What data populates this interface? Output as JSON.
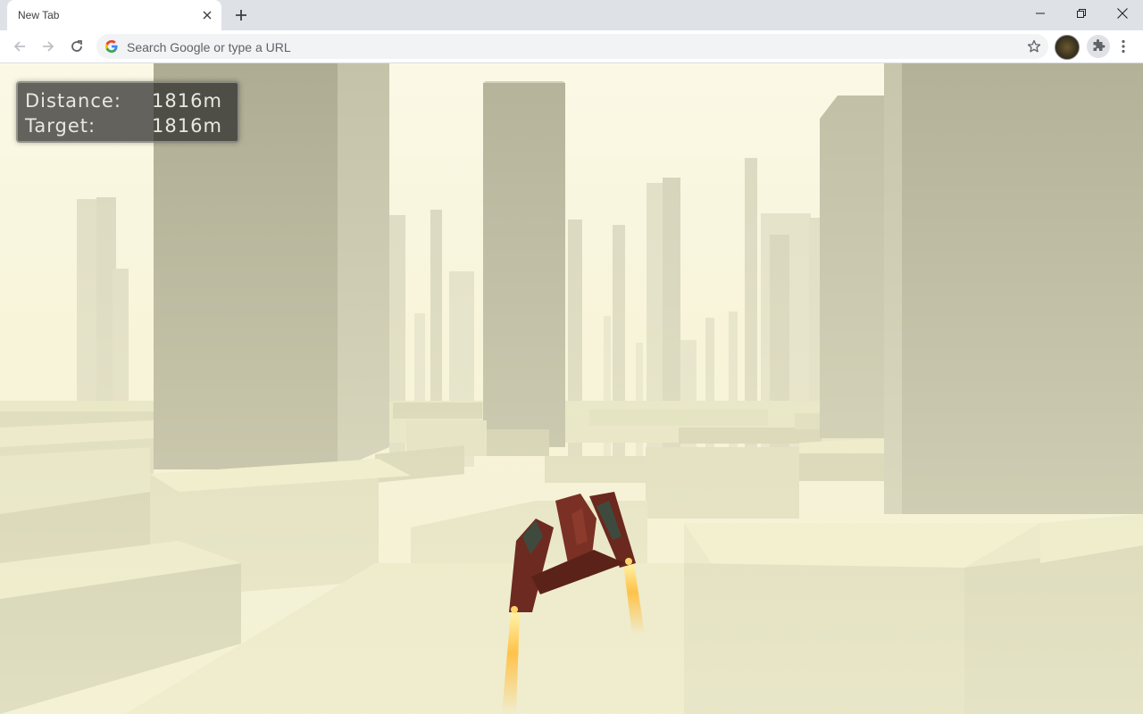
{
  "browser": {
    "tab_title": "New Tab",
    "omnibox_placeholder": "Search Google or type a URL",
    "icons": {
      "back": "arrow-left-icon",
      "forward": "arrow-right-icon",
      "reload": "reload-icon",
      "new_tab": "plus-icon",
      "close_tab": "close-icon",
      "bookmark": "star-icon",
      "extensions": "puzzle-icon",
      "menu": "kebab-menu-icon",
      "minimize": "minimize-icon",
      "restore": "restore-icon",
      "close_window": "close-icon"
    }
  },
  "game": {
    "hud": {
      "distance_label": "Distance:",
      "distance_value": "1816m",
      "target_label": "Target:",
      "target_value": "1816m"
    },
    "colors": {
      "sky": "#fbf8e2",
      "block_top": "#e9e8b8",
      "block_side": "#bdbc96",
      "tower": "#b8b79c",
      "ship": "#7a2e22",
      "flame": "#ffc24a"
    }
  }
}
